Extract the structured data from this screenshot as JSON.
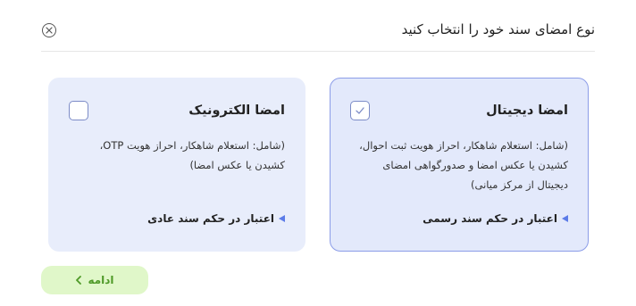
{
  "dialog": {
    "title": "نوع امضای سند خود را انتخاب کنید"
  },
  "cards": {
    "digital": {
      "title": "امضا دیجیتال",
      "description": "(شامل: استعلام شاهکار، احراز هویت ثبت احوال، کشیدن یا عکس امضا و صدورگواهی امضای دیجیتال از مرکز میانی)",
      "link": "اعتبار در حکم سند رسمی",
      "checked": true
    },
    "electronic": {
      "title": "امضا الکترونیک",
      "description": "(شامل: استعلام شاهکار، احراز هویت OTP، کشیدن یا عکس امضا)",
      "link": "اعتبار در حکم سند عادی",
      "checked": false
    }
  },
  "actions": {
    "continue_label": "ادامه"
  },
  "colors": {
    "accent": "#5b7be8",
    "card_bg": "#e8edfb",
    "selected_border": "#8c9de8",
    "continue_bg": "#e0f7c9",
    "continue_text": "#4f9a28"
  },
  "icons": {
    "close": "close-circle-icon",
    "check": "check-icon",
    "link_marker": "triangle-left-icon",
    "continue_arrow": "chevron-left-icon"
  }
}
